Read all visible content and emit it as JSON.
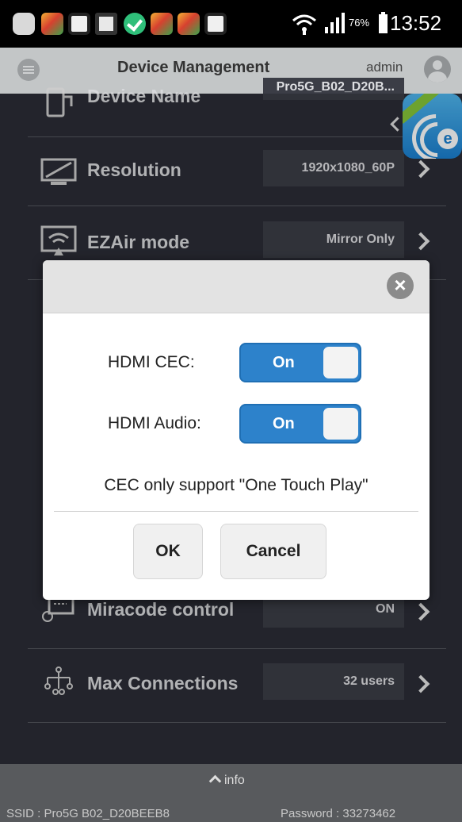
{
  "status_bar": {
    "battery_percent": "76%",
    "time": "13:52",
    "icons": [
      "message-icon",
      "app-icon",
      "s-icon",
      "gallery-icon",
      "check-icon",
      "app-icon",
      "app-icon",
      "s-icon",
      "wifi-icon",
      "signal-icon",
      "battery-icon"
    ]
  },
  "header": {
    "title": "Device Management",
    "user": "admin"
  },
  "settings": [
    {
      "label": "Device Name",
      "value": "Pro5G_B02_D20B..."
    },
    {
      "label": "Resolution",
      "value": "1920x1080_60P"
    },
    {
      "label": "EZAir mode",
      "value": "Mirror Only"
    },
    {
      "label": "Miracode control",
      "value": "ON"
    },
    {
      "label": "Max Connections",
      "value": "32 users"
    }
  ],
  "dialog": {
    "close_symbol": "×",
    "hdmi_cec_label": "HDMI CEC:",
    "hdmi_cec_state": "On",
    "hdmi_audio_label": "HDMI Audio:",
    "hdmi_audio_state": "On",
    "note": "CEC only support \"One Touch Play\"",
    "ok_label": "OK",
    "cancel_label": "Cancel"
  },
  "footer": {
    "info_label": "info",
    "ssid": "SSID : Pro5G B02_D20BEEB8",
    "password": "Password : 33273462"
  },
  "colors": {
    "toggle_on": "#2d82cb",
    "background": "#2b2d36",
    "header": "#c3c6c7"
  }
}
